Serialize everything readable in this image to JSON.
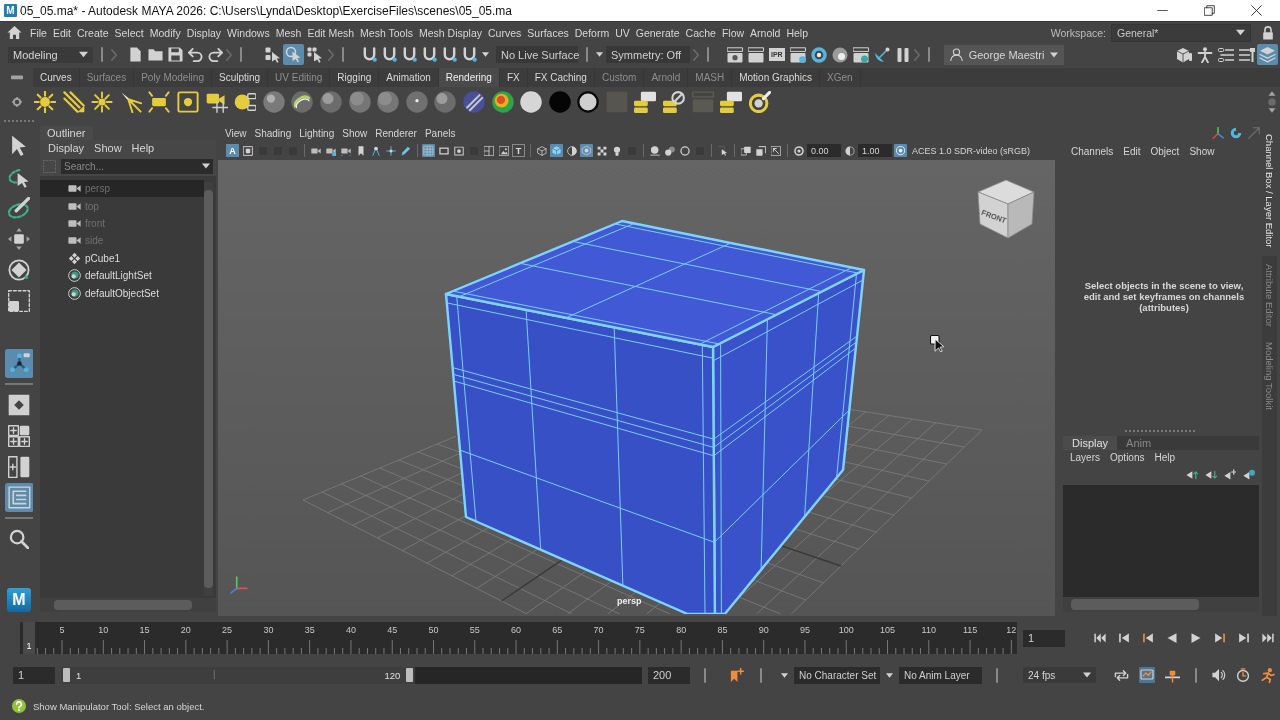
{
  "window": {
    "app_icon": "M",
    "title": "05_05.ma* - Autodesk MAYA 2026: C:\\Users\\Lynda\\Desktop\\ExerciseFiles\\scenes\\05_05.ma"
  },
  "menu_bar": {
    "items": [
      "File",
      "Edit",
      "Create",
      "Select",
      "Modify",
      "Display",
      "Windows",
      "Mesh",
      "Edit Mesh",
      "Mesh Tools",
      "Mesh Display",
      "Curves",
      "Surfaces",
      "Deform",
      "UV",
      "Generate",
      "Cache",
      "Flow",
      "Arnold",
      "Help"
    ],
    "workspace_label": "Workspace:",
    "workspace": "General*"
  },
  "status_line": {
    "menu_set": "Modeling",
    "selection_modes": [
      {
        "kind": "hierarchy",
        "selected": false
      },
      {
        "kind": "object",
        "selected": true
      },
      {
        "kind": "component",
        "selected": false
      }
    ],
    "live_surface": "No Live Surface",
    "symmetry": "Symmetry: Off",
    "ipr_label": "IPR",
    "user": "George Maestri",
    "panel_toggles": [
      {
        "kind": "toolkit",
        "on": false
      },
      {
        "kind": "character",
        "on": false
      },
      {
        "kind": "attributes",
        "on": false
      },
      {
        "kind": "settings",
        "on": false
      },
      {
        "kind": "channels",
        "on": true
      }
    ]
  },
  "shelf": {
    "tabs": [
      {
        "label": "Curves",
        "dimmed": false,
        "selected": false
      },
      {
        "label": "Surfaces",
        "dimmed": true,
        "selected": false
      },
      {
        "label": "Poly Modeling",
        "dimmed": true,
        "selected": false
      },
      {
        "label": "Sculpting",
        "dimmed": false,
        "selected": false
      },
      {
        "label": "UV Editing",
        "dimmed": true,
        "selected": false
      },
      {
        "label": "Rigging",
        "dimmed": false,
        "selected": false
      },
      {
        "label": "Animation",
        "dimmed": false,
        "selected": false
      },
      {
        "label": "Rendering",
        "dimmed": false,
        "selected": true
      },
      {
        "label": "FX",
        "dimmed": false,
        "selected": false
      },
      {
        "label": "FX Caching",
        "dimmed": false,
        "selected": false
      },
      {
        "label": "Custom",
        "dimmed": true,
        "selected": false
      },
      {
        "label": "Arnold",
        "dimmed": true,
        "selected": false
      },
      {
        "label": "MASH",
        "dimmed": true,
        "selected": false
      },
      {
        "label": "Motion Graphics",
        "dimmed": false,
        "selected": false
      },
      {
        "label": "XGen",
        "dimmed": true,
        "selected": false
      }
    ]
  },
  "toolbox": {
    "tools": [
      {
        "kind": "select",
        "selected": false
      },
      {
        "kind": "lasso",
        "selected": false
      },
      {
        "kind": "paint",
        "selected": false
      },
      {
        "kind": "move",
        "selected": false
      },
      {
        "kind": "rotate",
        "selected": false
      },
      {
        "kind": "scale",
        "selected": false
      },
      {
        "kind": "manipulator",
        "selected": true
      }
    ],
    "layouts": [
      {
        "kind": "single",
        "selected": false
      },
      {
        "kind": "four",
        "selected": false
      },
      {
        "kind": "two",
        "selected": false
      },
      {
        "kind": "outliner",
        "selected": true
      }
    ],
    "logo": "M"
  },
  "outliner": {
    "title": "Outliner",
    "menus": [
      "Display",
      "Show",
      "Help"
    ],
    "search": {
      "placeholder": "Search..."
    },
    "items": [
      {
        "kind": "camera",
        "label": "persp",
        "dimmed": true,
        "highlighted": true
      },
      {
        "kind": "camera",
        "label": "top",
        "dimmed": true,
        "highlighted": false
      },
      {
        "kind": "camera",
        "label": "front",
        "dimmed": true,
        "highlighted": false
      },
      {
        "kind": "camera",
        "label": "side",
        "dimmed": true,
        "highlighted": false
      },
      {
        "kind": "mesh",
        "label": "pCube1",
        "dimmed": false,
        "highlighted": false
      },
      {
        "kind": "set",
        "label": "defaultLightSet",
        "dimmed": false,
        "highlighted": false
      },
      {
        "kind": "set",
        "label": "defaultObjectSet",
        "dimmed": false,
        "highlighted": false
      }
    ]
  },
  "viewport": {
    "menus": [
      "View",
      "Shading",
      "Lighting",
      "Show",
      "Renderer",
      "Panels"
    ],
    "toolbar": [
      [
        {
          "kind": "letter",
          "label": "A",
          "on": true
        },
        {
          "kind": "frame",
          "on": false
        },
        {
          "kind": "dim",
          "on": false
        },
        {
          "kind": "dim",
          "on": false
        },
        {
          "kind": "dim",
          "on": false
        }
      ],
      [
        {
          "kind": "camera",
          "on": false
        },
        {
          "kind": "camlock",
          "on": false
        },
        {
          "kind": "camrot",
          "on": false
        },
        {
          "kind": "bookmark",
          "on": false
        },
        {
          "kind": "pan2d",
          "on": false
        },
        {
          "kind": "panarrows",
          "on": false
        },
        {
          "kind": "pencil",
          "on": false
        }
      ],
      [
        {
          "kind": "grid",
          "on": true
        },
        {
          "kind": "film",
          "on": false
        },
        {
          "kind": "gate",
          "on": false
        },
        {
          "kind": "dim",
          "on": false
        },
        {
          "kind": "split",
          "on": false
        },
        {
          "kind": "imageplane",
          "on": false
        },
        {
          "kind": "letter",
          "label": "T",
          "on": false
        }
      ],
      [
        {
          "kind": "wirecube",
          "on": false
        },
        {
          "kind": "shadedcube",
          "on": true
        },
        {
          "kind": "halfsphere",
          "on": false
        },
        {
          "kind": "xray",
          "on": true
        },
        {
          "kind": "checker",
          "on": false
        },
        {
          "kind": "bulb",
          "on": false
        },
        {
          "kind": "dim",
          "on": false
        }
      ],
      [
        {
          "kind": "spherelit",
          "on": false
        },
        {
          "kind": "spheres",
          "on": false
        },
        {
          "kind": "ring",
          "on": false
        },
        {
          "kind": "dim",
          "on": false
        }
      ],
      [
        {
          "kind": "cursorbox",
          "on": false
        }
      ],
      [
        {
          "kind": "isolate",
          "on": false
        },
        {
          "kind": "squares",
          "on": false
        },
        {
          "kind": "resize",
          "on": false
        }
      ]
    ],
    "exposure": "0.00",
    "gamma": "1.00",
    "color_management": {
      "on": true,
      "label": "ACES 1.0 SDR-video (sRGB)"
    },
    "view_cube_label": "FRONT",
    "camera": "persp"
  },
  "channel_box": {
    "menus": [
      "Channels",
      "Edit",
      "Object",
      "Show"
    ],
    "message": "Select objects in the scene to view, edit and set keyframes on channels (attributes)"
  },
  "layer_editor": {
    "tabs": [
      {
        "label": "Display",
        "selected": true
      },
      {
        "label": "Anim",
        "selected": false
      }
    ],
    "menus": [
      "Layers",
      "Options",
      "Help"
    ]
  },
  "side_tabs": [
    {
      "label": "Channel Box / Layer Editor",
      "selected": true
    },
    {
      "label": "Attribute Editor",
      "selected": false
    },
    {
      "label": "Modeling Toolkit",
      "selected": false
    }
  ],
  "time_slider": {
    "level": 0,
    "current_marker": "1",
    "labels": [
      "5",
      "10",
      "15",
      "20",
      "25",
      "30",
      "35",
      "40",
      "45",
      "50",
      "55",
      "60",
      "65",
      "70",
      "75",
      "80",
      "85",
      "90",
      "95",
      "100",
      "105",
      "110",
      "115",
      "12"
    ],
    "current_frame": "1"
  },
  "range_slider": {
    "start": "1",
    "level": 0.61,
    "range_start": "1",
    "range_end": "120",
    "end": "200",
    "character_set": "No Character Set",
    "anim_layer": "No Anim Layer",
    "fps": "24 fps"
  },
  "help_line": {
    "text": "Show Manipulator Tool: Select an object."
  }
}
